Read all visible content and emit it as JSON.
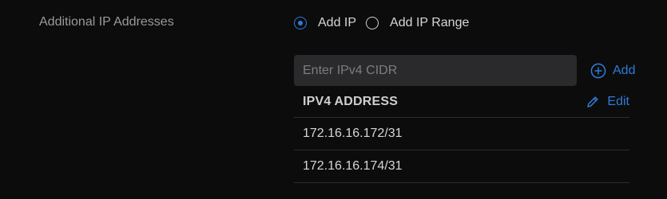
{
  "field": {
    "label": "Additional IP Addresses"
  },
  "radio": {
    "options": [
      {
        "label": "Add IP",
        "selected": true
      },
      {
        "label": "Add IP Range",
        "selected": false
      }
    ]
  },
  "input": {
    "placeholder": "Enter IPv4 CIDR",
    "value": ""
  },
  "add_button": {
    "label": "Add",
    "icon": "plus-circle-icon"
  },
  "table": {
    "column_header": "IPV4 ADDRESS",
    "edit_label": "Edit",
    "edit_icon": "pencil-icon",
    "rows": [
      {
        "address": "172.16.16.172/31"
      },
      {
        "address": "172.16.16.174/31"
      }
    ]
  },
  "colors": {
    "background": "#0c0c0c",
    "accent": "#2f7bd8",
    "input_bg": "#2a2a2c",
    "divider": "#2e2e2e"
  }
}
